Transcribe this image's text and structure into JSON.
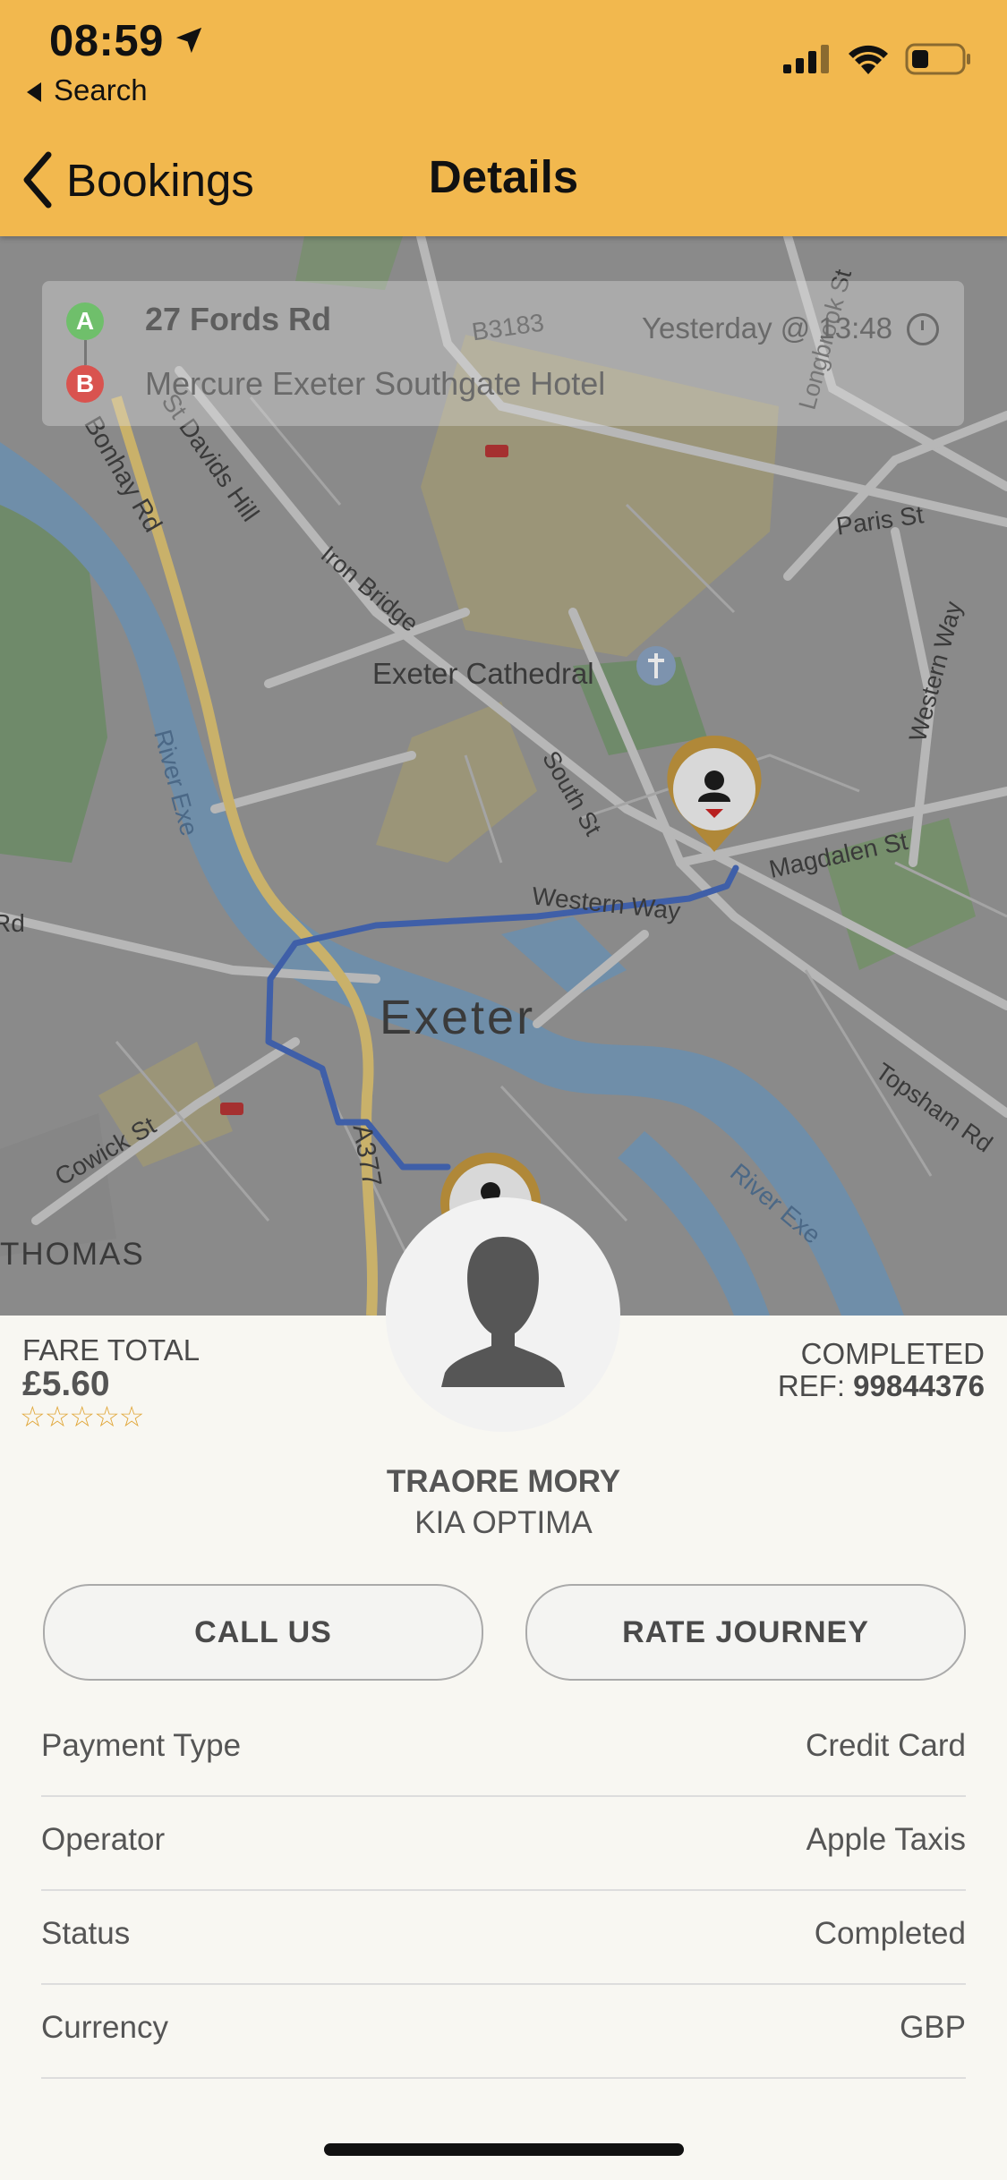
{
  "status_bar": {
    "time": "08:59",
    "back_app": "Search"
  },
  "nav": {
    "back_label": "Bookings",
    "title": "Details"
  },
  "route": {
    "pickup_marker": "A",
    "dropoff_marker": "B",
    "pickup": "27 Fords Rd",
    "dropoff": "Mercure Exeter Southgate Hotel",
    "time": "Yesterday @ 13:48"
  },
  "map": {
    "labels": {
      "b3183": "B3183",
      "longbrook": "Longbrook St",
      "st_davids": "St Davids Hill",
      "bonhay": "Bonhay Rd",
      "paris": "Paris St",
      "iron_bridge": "Iron Bridge",
      "cathedral": "Exeter Cathedral",
      "western_way_r": "Western Way",
      "south_st": "South St",
      "river_exe_l": "River Exe",
      "magdalen": "Magdalen St",
      "western_way": "Western Way",
      "rd": "Rd",
      "exeter": "Exeter",
      "a377": "A377",
      "topsham": "Topsham Rd",
      "cowick": "Cowick St",
      "river_exe_r": "River Exe",
      "thomas": "THOMAS"
    }
  },
  "fare": {
    "label": "FARE TOTAL",
    "amount": "£5.60",
    "rating": "☆☆☆☆☆"
  },
  "booking": {
    "status": "COMPLETED",
    "ref_label": "REF: ",
    "ref_number": "99844376"
  },
  "driver": {
    "name": "TRAORE MORY",
    "vehicle": "KIA OPTIMA"
  },
  "actions": {
    "call": "CALL US",
    "rate": "RATE JOURNEY"
  },
  "details": [
    {
      "key": "Payment Type",
      "value": "Credit Card"
    },
    {
      "key": "Operator",
      "value": "Apple Taxis"
    },
    {
      "key": "Status",
      "value": "Completed"
    },
    {
      "key": "Currency",
      "value": "GBP"
    }
  ],
  "colors": {
    "header": "#f2b84e",
    "route": "#3f5fa8",
    "river": "#6f8ea9",
    "marker": "#b08838"
  },
  "icons": {
    "back": "chevron-left-icon",
    "location": "location-arrow-icon",
    "signal": "cellular-signal-icon",
    "wifi": "wifi-icon",
    "battery": "battery-icon",
    "clock": "clock-icon",
    "driver_avatar": "person-silhouette-icon"
  }
}
